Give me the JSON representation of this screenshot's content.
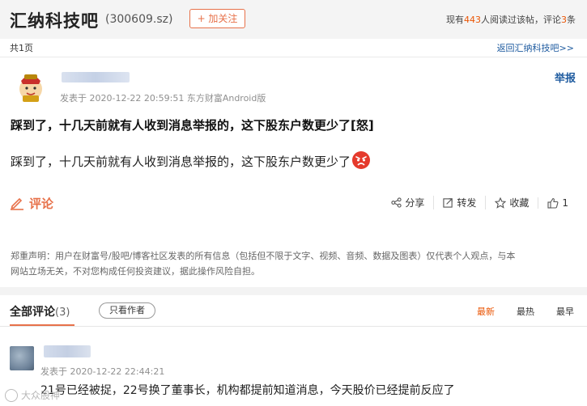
{
  "header": {
    "bar_title": "汇纳科技吧",
    "stock_code": "(300609.sz)",
    "follow_label": "+ 加关注",
    "stats_prefix": "现有",
    "readers": "443",
    "stats_mid": "人阅读过该帖，评论",
    "comments": "3",
    "stats_suffix": "条"
  },
  "nav": {
    "page_info": "共1页",
    "back_link": "返回汇纳科技吧>>"
  },
  "post": {
    "meta": "发表于 2020-12-22 20:59:51 东方财富Android版",
    "report_label": "举报",
    "title": "踩到了，十几天前就有人收到消息举报的，这下股东户数更少了[怒]",
    "body": "踩到了，十几天前就有人收到消息举报的，这下股东户数更少了",
    "emoji_icon": "angry-face-icon"
  },
  "actions": {
    "comment_label": "评论",
    "share_label": "分享",
    "repost_label": "转发",
    "favorite_label": "收藏",
    "like_count": "1"
  },
  "disclaimer": {
    "line1": "郑重声明：用户在财富号/股吧/博客社区发表的所有信息（包括但不限于文字、视频、音频、数据及图表）仅代表个人观点，与本",
    "line2": "网站立场无关，不对您构成任何投资建议，据此操作风险自担。"
  },
  "comments_section": {
    "tab_label": "全部评论",
    "tab_count": "(3)",
    "author_only_label": "只看作者",
    "sort_options": [
      "最新",
      "最热",
      "最早"
    ],
    "active_sort": "最新"
  },
  "comment": {
    "meta": "发表于 2020-12-22 22:44:21",
    "text": "21号已经被捉，22号换了董事长，机构都提前知道消息，今天股价已经提前反应了"
  },
  "watermark": "大众股神",
  "colors": {
    "accent": "#e7714a",
    "link": "#1d5a9f",
    "highlight": "#ea5504"
  }
}
